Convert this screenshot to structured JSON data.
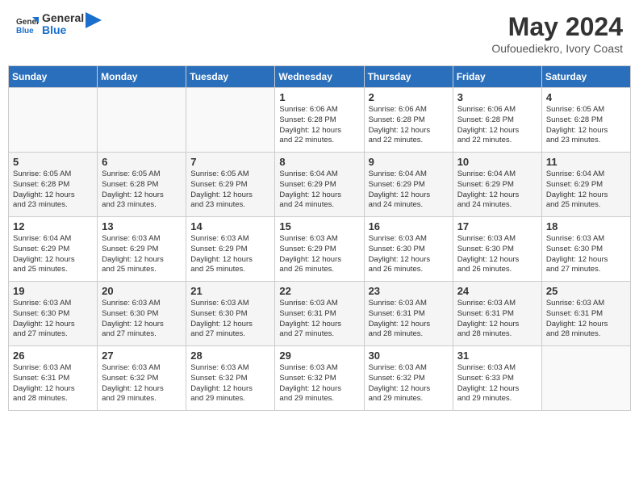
{
  "logo": {
    "general": "General",
    "blue": "Blue"
  },
  "header": {
    "month_year": "May 2024",
    "location": "Oufouediekro, Ivory Coast"
  },
  "days_of_week": [
    "Sunday",
    "Monday",
    "Tuesday",
    "Wednesday",
    "Thursday",
    "Friday",
    "Saturday"
  ],
  "weeks": [
    [
      {
        "day": "",
        "info": ""
      },
      {
        "day": "",
        "info": ""
      },
      {
        "day": "",
        "info": ""
      },
      {
        "day": "1",
        "info": "Sunrise: 6:06 AM\nSunset: 6:28 PM\nDaylight: 12 hours\nand 22 minutes."
      },
      {
        "day": "2",
        "info": "Sunrise: 6:06 AM\nSunset: 6:28 PM\nDaylight: 12 hours\nand 22 minutes."
      },
      {
        "day": "3",
        "info": "Sunrise: 6:06 AM\nSunset: 6:28 PM\nDaylight: 12 hours\nand 22 minutes."
      },
      {
        "day": "4",
        "info": "Sunrise: 6:05 AM\nSunset: 6:28 PM\nDaylight: 12 hours\nand 23 minutes."
      }
    ],
    [
      {
        "day": "5",
        "info": "Sunrise: 6:05 AM\nSunset: 6:28 PM\nDaylight: 12 hours\nand 23 minutes."
      },
      {
        "day": "6",
        "info": "Sunrise: 6:05 AM\nSunset: 6:28 PM\nDaylight: 12 hours\nand 23 minutes."
      },
      {
        "day": "7",
        "info": "Sunrise: 6:05 AM\nSunset: 6:29 PM\nDaylight: 12 hours\nand 23 minutes."
      },
      {
        "day": "8",
        "info": "Sunrise: 6:04 AM\nSunset: 6:29 PM\nDaylight: 12 hours\nand 24 minutes."
      },
      {
        "day": "9",
        "info": "Sunrise: 6:04 AM\nSunset: 6:29 PM\nDaylight: 12 hours\nand 24 minutes."
      },
      {
        "day": "10",
        "info": "Sunrise: 6:04 AM\nSunset: 6:29 PM\nDaylight: 12 hours\nand 24 minutes."
      },
      {
        "day": "11",
        "info": "Sunrise: 6:04 AM\nSunset: 6:29 PM\nDaylight: 12 hours\nand 25 minutes."
      }
    ],
    [
      {
        "day": "12",
        "info": "Sunrise: 6:04 AM\nSunset: 6:29 PM\nDaylight: 12 hours\nand 25 minutes."
      },
      {
        "day": "13",
        "info": "Sunrise: 6:03 AM\nSunset: 6:29 PM\nDaylight: 12 hours\nand 25 minutes."
      },
      {
        "day": "14",
        "info": "Sunrise: 6:03 AM\nSunset: 6:29 PM\nDaylight: 12 hours\nand 25 minutes."
      },
      {
        "day": "15",
        "info": "Sunrise: 6:03 AM\nSunset: 6:29 PM\nDaylight: 12 hours\nand 26 minutes."
      },
      {
        "day": "16",
        "info": "Sunrise: 6:03 AM\nSunset: 6:30 PM\nDaylight: 12 hours\nand 26 minutes."
      },
      {
        "day": "17",
        "info": "Sunrise: 6:03 AM\nSunset: 6:30 PM\nDaylight: 12 hours\nand 26 minutes."
      },
      {
        "day": "18",
        "info": "Sunrise: 6:03 AM\nSunset: 6:30 PM\nDaylight: 12 hours\nand 27 minutes."
      }
    ],
    [
      {
        "day": "19",
        "info": "Sunrise: 6:03 AM\nSunset: 6:30 PM\nDaylight: 12 hours\nand 27 minutes."
      },
      {
        "day": "20",
        "info": "Sunrise: 6:03 AM\nSunset: 6:30 PM\nDaylight: 12 hours\nand 27 minutes."
      },
      {
        "day": "21",
        "info": "Sunrise: 6:03 AM\nSunset: 6:30 PM\nDaylight: 12 hours\nand 27 minutes."
      },
      {
        "day": "22",
        "info": "Sunrise: 6:03 AM\nSunset: 6:31 PM\nDaylight: 12 hours\nand 27 minutes."
      },
      {
        "day": "23",
        "info": "Sunrise: 6:03 AM\nSunset: 6:31 PM\nDaylight: 12 hours\nand 28 minutes."
      },
      {
        "day": "24",
        "info": "Sunrise: 6:03 AM\nSunset: 6:31 PM\nDaylight: 12 hours\nand 28 minutes."
      },
      {
        "day": "25",
        "info": "Sunrise: 6:03 AM\nSunset: 6:31 PM\nDaylight: 12 hours\nand 28 minutes."
      }
    ],
    [
      {
        "day": "26",
        "info": "Sunrise: 6:03 AM\nSunset: 6:31 PM\nDaylight: 12 hours\nand 28 minutes."
      },
      {
        "day": "27",
        "info": "Sunrise: 6:03 AM\nSunset: 6:32 PM\nDaylight: 12 hours\nand 29 minutes."
      },
      {
        "day": "28",
        "info": "Sunrise: 6:03 AM\nSunset: 6:32 PM\nDaylight: 12 hours\nand 29 minutes."
      },
      {
        "day": "29",
        "info": "Sunrise: 6:03 AM\nSunset: 6:32 PM\nDaylight: 12 hours\nand 29 minutes."
      },
      {
        "day": "30",
        "info": "Sunrise: 6:03 AM\nSunset: 6:32 PM\nDaylight: 12 hours\nand 29 minutes."
      },
      {
        "day": "31",
        "info": "Sunrise: 6:03 AM\nSunset: 6:33 PM\nDaylight: 12 hours\nand 29 minutes."
      },
      {
        "day": "",
        "info": ""
      }
    ]
  ]
}
